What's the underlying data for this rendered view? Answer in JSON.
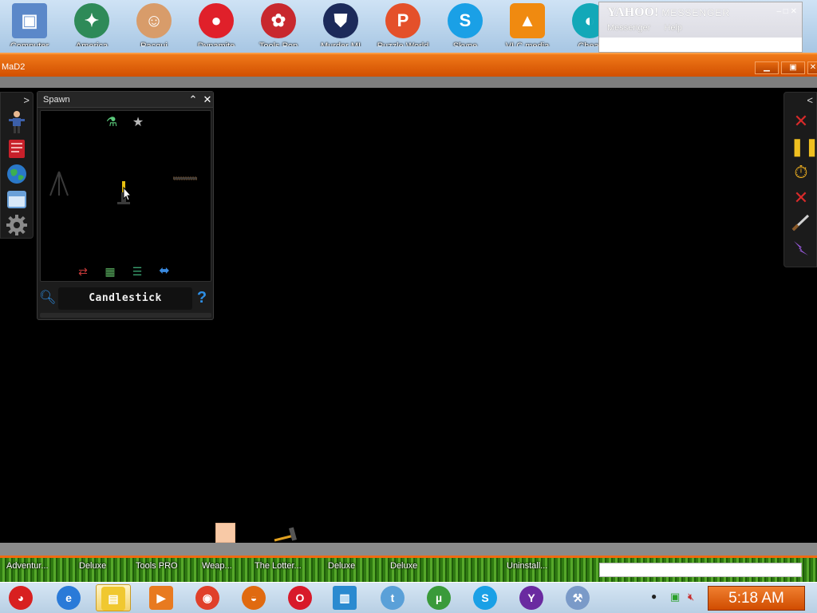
{
  "desktop": {
    "icons": [
      {
        "label": "Computer",
        "icon": "computer-icon"
      },
      {
        "label": "America",
        "icon": "compass-icon"
      },
      {
        "label": "Pacqui",
        "icon": "avatar-icon"
      },
      {
        "label": "Dynamite",
        "icon": "ball-icon"
      },
      {
        "label": "Tools Pop",
        "icon": "bird-icon"
      },
      {
        "label": "Murder MI",
        "icon": "shield-icon"
      },
      {
        "label": "Puzzle World",
        "icon": "p-badge-icon"
      },
      {
        "label": "Skype",
        "icon": "skype-icon"
      },
      {
        "label": "VLC media",
        "icon": "vlc-cone-icon"
      },
      {
        "label": "Cheat",
        "icon": "lock-icon"
      }
    ],
    "bottom_labels": [
      "Adventur...",
      "Deluxe",
      "Tools PRO",
      "Weap...",
      "The Lotter...",
      "Deluxe",
      "Deluxe",
      "Uninstall..."
    ]
  },
  "yahoo_messenger": {
    "brand": "YAHOO!",
    "product": "MESSENGER",
    "menu": [
      "Messenger",
      "Help"
    ]
  },
  "window": {
    "title": "MaD2"
  },
  "spawn_panel": {
    "title": "Spawn",
    "selected_item": "Candlestick",
    "category_icons": [
      "flask-icon",
      "star-icon"
    ],
    "bottom_icons": [
      "sliders-icon",
      "grid-icon",
      "list-icon",
      "swap-arrows-icon"
    ]
  },
  "left_toolbar": [
    "character-icon",
    "book-icon",
    "globe-icon",
    "window-icon",
    "gear-icon"
  ],
  "right_toolbar": [
    "close-x-icon",
    "pause-icon",
    "stopwatch-icon",
    "delete-x-icon",
    "knife-icon",
    "lightning-icon"
  ],
  "taskbar": {
    "clock": "5:18 AM"
  },
  "colors": {
    "accent": "#e0600c",
    "panel": "#1c1c1c",
    "link_blue": "#2e8fe6"
  }
}
